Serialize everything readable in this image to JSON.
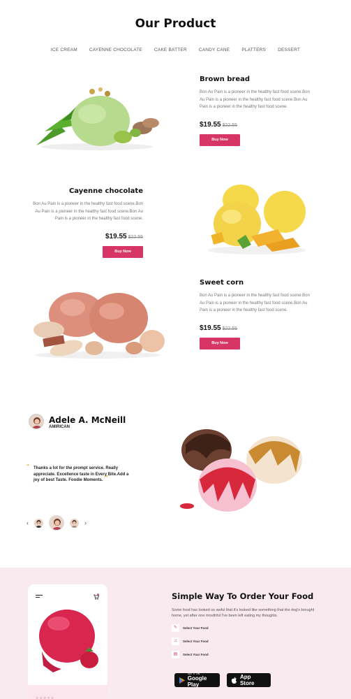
{
  "header": {
    "title": "Our Product"
  },
  "tabs": [
    "ICE CREAM",
    "CAYENNE CHOCOLATE",
    "CAKE BATTER",
    "CANDY CANE",
    "PLATTERS",
    "DESSERT"
  ],
  "products": [
    {
      "name": "Brown bread",
      "desc": "Bon Au Pain is a pioneer in the healthy fast food scene.Bon Au Pain is a pioneer in the healthy fast food scene.Bon Au Pain is a pioneer in the healthy fast food scene.",
      "price": "$19.55",
      "old_price": "$22.55",
      "button": "Buy Now"
    },
    {
      "name": "Cayenne chocolate",
      "desc": "Bon Au Pain is a pioneer in the healthy fast food scene.Bon Au Pain is a pioneer in the healthy fast food scene.Bon Au Pain is a pioneer in the healthy fast food scene.",
      "price": "$19.55",
      "old_price": "$22.55",
      "button": "Buy Now"
    },
    {
      "name": "Sweet corn",
      "desc": "Bon Au Pain is a pioneer in the healthy fast food scene.Bon Au Pain is a pioneer in the healthy fast food scene.Bon Au Pain is a pioneer in the healthy fast food scene.",
      "price": "$19.55",
      "old_price": "$22.55",
      "button": "Buy Now"
    }
  ],
  "testimonial": {
    "name": "Adele A. McNeill",
    "role": "AMIRICAN",
    "quote": "Thanks a lot for the prompt service. Really appreciate. Excellence taste in Every Bite.Add a joy of best Taste. Foodie Moments.",
    "quote_open": "“",
    "quote_close": "”",
    "prev": "‹",
    "next": "›"
  },
  "app": {
    "title": "Simple Way To Order Your Food",
    "desc": "Some food has looked so awful that it's looked like something that the dog's brought home, yet after one mouthful I've been left eating my thoughts.",
    "steps": [
      "Select Your Food",
      "Select Your Food",
      "Select Your Food"
    ],
    "stars": "★★★★★",
    "google": {
      "small": "GET IT ON",
      "big": "Google Play"
    },
    "apple": {
      "big": "App Store"
    }
  },
  "colors": {
    "accent": "#d63565",
    "section_bg": "#f8eaef",
    "quote_mark": "#d9a200"
  },
  "icons": [
    "menu-icon",
    "cart-icon",
    "play-store-icon",
    "apple-icon",
    "step-icon"
  ]
}
